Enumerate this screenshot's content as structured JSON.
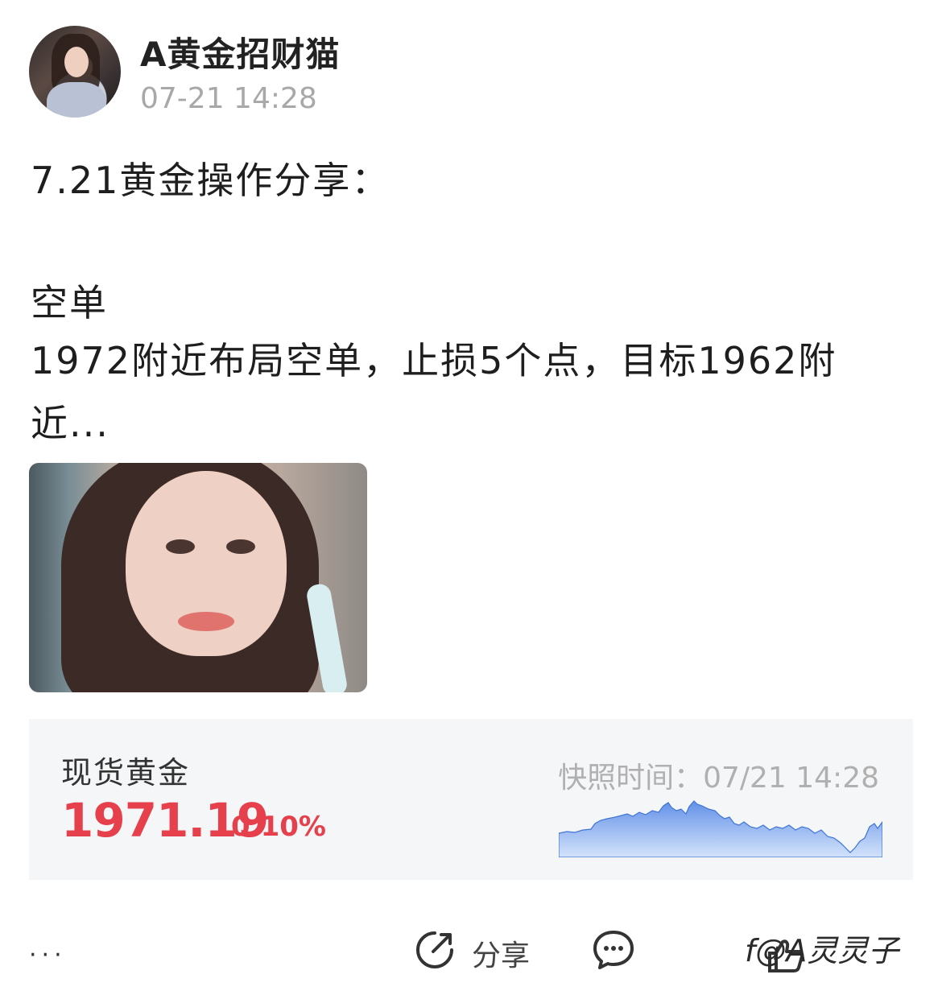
{
  "author": {
    "name": "A黄金招财猫",
    "time": "07-21 14:28"
  },
  "post": {
    "line1": "7.21黄金操作分享：",
    "line2": "空单",
    "line3": "1972附近布局空单，止损5个点，目标1962附",
    "line4": "近..."
  },
  "quote_card": {
    "name": "现货黄金",
    "price": "1971.19",
    "change": "0.10%",
    "snapshot": "快照时间：07/21 14:28",
    "accent_color": "#e5404c",
    "sparkline_color": "#3f74d6"
  },
  "actions": {
    "more": "···",
    "share_label": "分享"
  },
  "watermark": "f@A灵灵子"
}
